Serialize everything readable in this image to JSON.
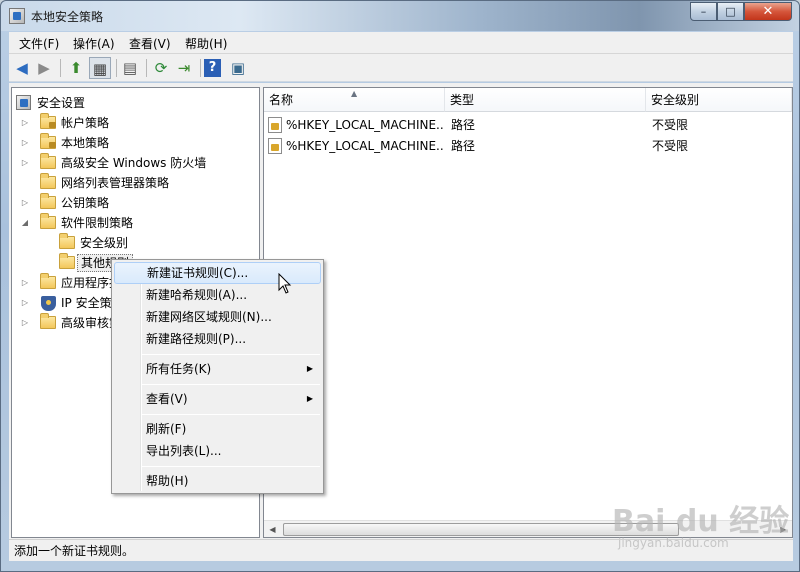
{
  "window": {
    "title": "本地安全策略",
    "min_glyph": "–",
    "max_glyph": "□",
    "close_glyph": "✕"
  },
  "menubar": {
    "items": [
      {
        "label": "文件(F)"
      },
      {
        "label": "操作(A)"
      },
      {
        "label": "查看(V)"
      },
      {
        "label": "帮助(H)"
      }
    ]
  },
  "toolbar": {
    "icons": [
      "back-icon",
      "forward-icon",
      "up-folder-icon",
      "show-hide-tree-icon",
      "copy-icon",
      "refresh-icon",
      "export-list-icon",
      "help-icon",
      "properties-icon"
    ],
    "glyphs": {
      "back": "◀",
      "forward": "▶",
      "up": "⬆",
      "tree": "▦",
      "copy": "▤",
      "refresh": "⟳",
      "export": "⇥",
      "help": "?",
      "props": "▣"
    }
  },
  "tree": {
    "items": [
      {
        "label": "安全设置"
      },
      {
        "label": "帐户策略"
      },
      {
        "label": "本地策略"
      },
      {
        "label": "高级安全 Windows 防火墙"
      },
      {
        "label": "网络列表管理器策略"
      },
      {
        "label": "公钥策略"
      },
      {
        "label": "软件限制策略"
      },
      {
        "label": "安全级别"
      },
      {
        "label": "其他规则"
      },
      {
        "label": "应用程序控"
      },
      {
        "label": "IP 安全策略"
      },
      {
        "label": "高级审核策"
      }
    ],
    "expander_collapsed": "▷",
    "expander_expanded": "◢"
  },
  "list": {
    "columns": [
      "名称",
      "类型",
      "安全级别"
    ],
    "sort_glyph": "▲",
    "rows": [
      {
        "name": "%HKEY_LOCAL_MACHINE...",
        "type": "路径",
        "level": "不受限"
      },
      {
        "name": "%HKEY_LOCAL_MACHINE...",
        "type": "路径",
        "level": "不受限"
      }
    ],
    "scroll_left": "◀",
    "scroll_right": "▶"
  },
  "context_menu": {
    "items": [
      {
        "label": "新建证书规则(C)..."
      },
      {
        "label": "新建哈希规则(A)..."
      },
      {
        "label": "新建网络区域规则(N)..."
      },
      {
        "label": "新建路径规则(P)..."
      },
      {
        "label": "所有任务(K)"
      },
      {
        "label": "查看(V)"
      },
      {
        "label": "刷新(F)"
      },
      {
        "label": "导出列表(L)..."
      },
      {
        "label": "帮助(H)"
      }
    ],
    "submenu_arrow": "▶"
  },
  "status": {
    "text": "添加一个新证书规则。"
  },
  "watermark": {
    "main": "Bai du 经验",
    "sub": "jingyan.baidu.com"
  }
}
